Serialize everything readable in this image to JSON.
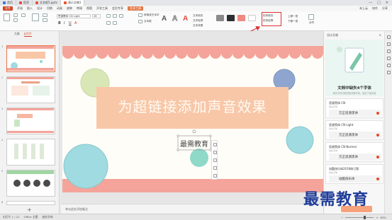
{
  "titlebar": {
    "tabs": [
      {
        "label": "首页"
      },
      {
        "label": "稻壳"
      },
      {
        "label": "文本框5.pptx"
      },
      {
        "label": "演示文稿1"
      }
    ],
    "active_tab": {
      "label": "演示文稿1"
    },
    "controls": [
      "—",
      "□",
      "✕"
    ]
  },
  "menubar": {
    "file": "文件",
    "items": [
      "开始",
      "插入",
      "设计",
      "切换",
      "动画",
      "放映",
      "审阅",
      "视图",
      "开发工具",
      "会员专享"
    ],
    "context_tab": "文本工具",
    "right_items": [
      "未上云",
      "协作",
      "分享"
    ]
  },
  "ribbon": {
    "font_name": "思源黑体 CN Light",
    "font_size": "28",
    "text_fill": "文本填充",
    "text_outline": "文本轮廓",
    "text_effect": "文本效果",
    "shape_fill": "形状填充",
    "shape_outline": "形状轮廓",
    "bring_forward": "上移一层",
    "send_backward": "下移一层",
    "align": "对齐",
    "convert_art": "转换成艺术字",
    "text_box": "文本框",
    "swatch_colors": [
      "#8a8a8a",
      "#2d2d2d",
      "#ef8a80",
      "#ffffff"
    ],
    "highlight_color": "#e03030"
  },
  "left_pane": {
    "tabs": [
      "大纲",
      "幻灯片"
    ],
    "active_tab": "幻灯片",
    "slide_numbers": [
      "1",
      "2",
      "3",
      "4",
      "5",
      "6"
    ],
    "selected_slide": "1",
    "add_label": "+"
  },
  "slide": {
    "title": "为超链接添加声音效果",
    "textbox": "最需教育",
    "accent_colors": {
      "scallop": "#f4a49a",
      "band": "#f8c7a8",
      "circle_green": "#d9e7b7",
      "circle_blue": "#8ea6cf",
      "circle_teal": "#9fdbe0",
      "circle_mint": "#8fd9c9"
    }
  },
  "notes": {
    "placeholder": "单击此处添加备注"
  },
  "right_pane": {
    "header": "设计灵感",
    "promo_title": "文档中缺失4个字体",
    "promo_sub": "缺失字体可能导致效果失真，建议下载安装",
    "fonts": [
      {
        "name": "思源黑体 CN",
        "tag": "缺失字体",
        "preview": "方正思源黑体"
      },
      {
        "name": "思源黑体 CN Light",
        "tag": "缺失字体",
        "preview": "方正思源黑体"
      },
      {
        "name": "思源黑体 CN Normal",
        "tag": "缺失字体",
        "preview": "方正思源黑体"
      },
      {
        "name": "站酷快乐体2016修订版",
        "tag": "缺失字体",
        "preview": "站酷快乐体"
      }
    ]
  },
  "statusbar": {
    "slide_info": "幻灯片 1 / 21",
    "theme": "Office 主题",
    "font_missing": "缺失字体",
    "zoom": "63%"
  },
  "watermark": {
    "text": "最需教育"
  }
}
